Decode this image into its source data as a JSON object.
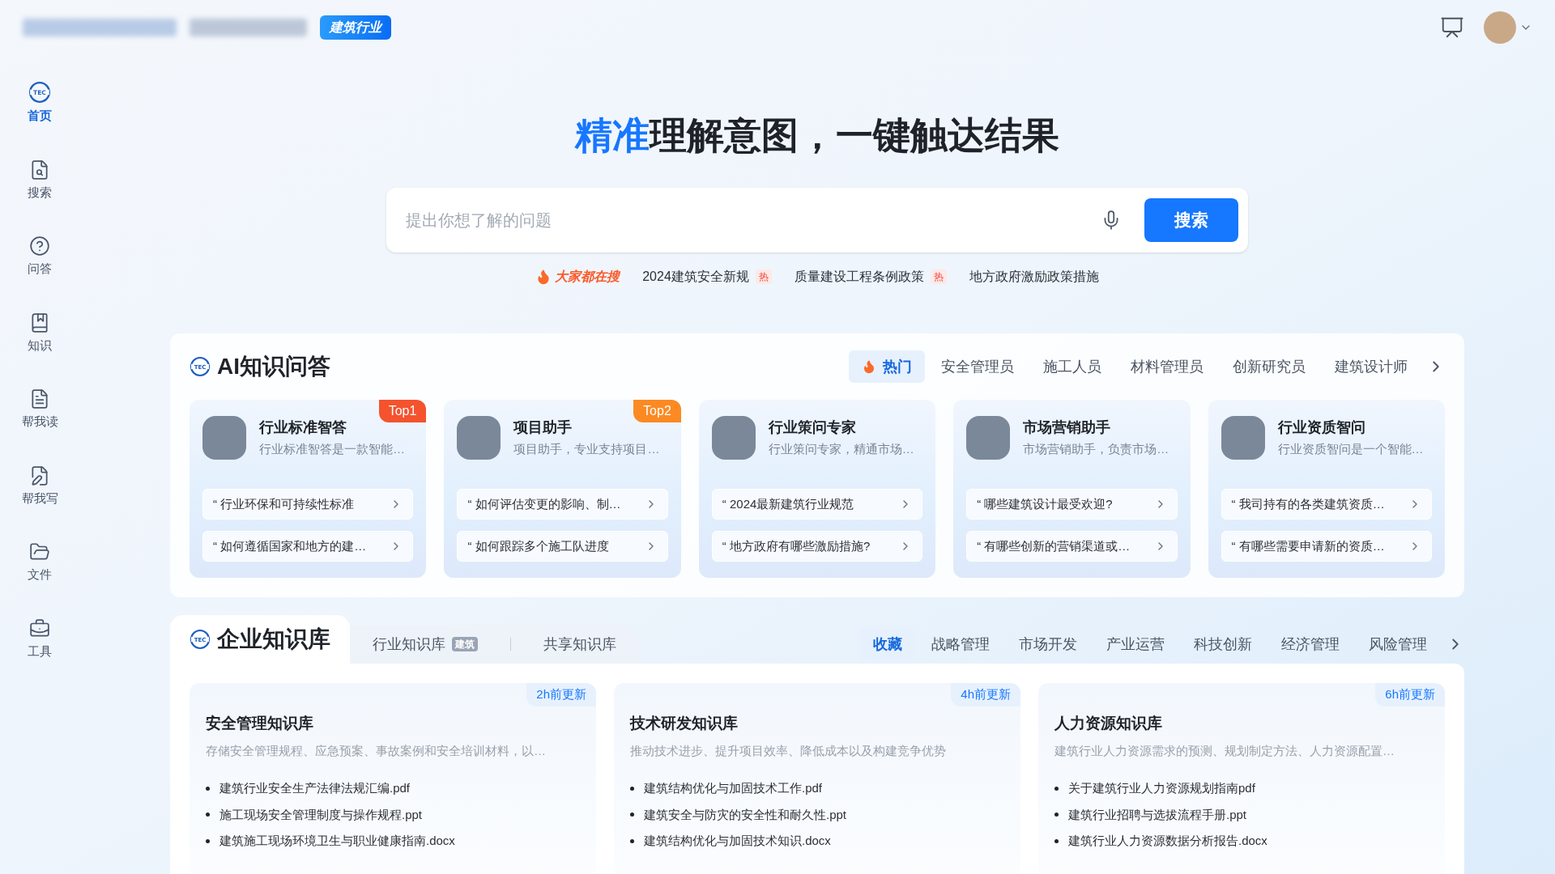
{
  "header": {
    "industry_badge": "建筑行业"
  },
  "sidebar": {
    "items": [
      {
        "label": "首页",
        "logo_text": "TEC",
        "selected": true
      },
      {
        "label": "搜索",
        "selected": false
      },
      {
        "label": "问答",
        "selected": false
      },
      {
        "label": "知识",
        "selected": false
      },
      {
        "label": "帮我读",
        "selected": false
      },
      {
        "label": "帮我写",
        "selected": false
      },
      {
        "label": "文件",
        "selected": false
      },
      {
        "label": "工具",
        "selected": false
      }
    ]
  },
  "hero": {
    "title_highlight": "精准",
    "title_rest": "理解意图，一键触达结果",
    "search": {
      "placeholder": "提出你想了解的问题",
      "button": "搜索"
    },
    "trending_label": "大家都在搜",
    "trending": [
      {
        "text": "2024建筑安全新规",
        "tag": "热"
      },
      {
        "text": "质量建设工程条例政策",
        "tag": "热"
      },
      {
        "text": "地方政府激励政策措施"
      }
    ]
  },
  "ai_qa": {
    "logo_text": "TEC",
    "title": "AI知识问答",
    "tabs": [
      {
        "label": "热门",
        "selected": true
      },
      {
        "label": "安全管理员",
        "selected": false
      },
      {
        "label": "施工人员",
        "selected": false
      },
      {
        "label": "材料管理员",
        "selected": false
      },
      {
        "label": "创新研究员",
        "selected": false
      },
      {
        "label": "建筑设计师",
        "selected": false
      }
    ],
    "cards": [
      {
        "name": "行业标准智答",
        "desc": "行业标准智答是一款智能…",
        "badge": {
          "text": "Top1",
          "color": "#f4532e"
        },
        "questions": [
          "“ 行业环保和可持续性标准",
          "“ 如何遵循国家和地方的建…"
        ]
      },
      {
        "name": "项目助手",
        "desc": "项目助手，专业支持项目…",
        "badge": {
          "text": "Top2",
          "color": "#fb8a23"
        },
        "questions": [
          "“ 如何评估变更的影响、制…",
          "“ 如何跟踪多个施工队进度"
        ]
      },
      {
        "name": "行业策问专家",
        "desc": "行业策问专家，精通市场…",
        "questions": [
          "“ 2024最新建筑行业规范",
          "“ 地方政府有哪些激励措施?"
        ]
      },
      {
        "name": "市场营销助手",
        "desc": "市场营销助手，负责市场…",
        "questions": [
          "“ 哪些建筑设计最受欢迎?",
          "“ 有哪些创新的营销渠道或…"
        ]
      },
      {
        "name": "行业资质智问",
        "desc": "行业资质智问是一个智能…",
        "questions": [
          "“ 我司持有的各类建筑资质…",
          "“ 有哪些需要申请新的资质…"
        ]
      }
    ]
  },
  "knowledge": {
    "logo_text": "TEC",
    "title": "企业知识库",
    "sources": [
      {
        "label": "行业知识库",
        "tag": "建筑"
      },
      {
        "label": "共享知识库"
      }
    ],
    "tabs": [
      {
        "label": "收藏",
        "selected": true
      },
      {
        "label": "战略管理",
        "selected": false
      },
      {
        "label": "市场开发",
        "selected": false
      },
      {
        "label": "产业运营",
        "selected": false
      },
      {
        "label": "科技创新",
        "selected": false
      },
      {
        "label": "经济管理",
        "selected": false
      },
      {
        "label": "风险管理",
        "selected": false
      }
    ],
    "cards": [
      {
        "updated": "2h前更新",
        "title": "安全管理知识库",
        "desc": "存储安全管理规程、应急预案、事故案例和安全培训材料，以…",
        "files": [
          "建筑行业安全生产法律法规汇编.pdf",
          "施工现场安全管理制度与操作规程.ppt",
          "建筑施工现场环境卫生与职业健康指南.docx"
        ]
      },
      {
        "updated": "4h前更新",
        "title": "技术研发知识库",
        "desc": "推动技术进步、提升项目效率、降低成本以及构建竞争优势",
        "files": [
          "建筑结构优化与加固技术工作.pdf",
          "建筑安全与防灾的安全性和耐久性.ppt",
          "建筑结构优化与加固技术知识.docx"
        ]
      },
      {
        "updated": "6h前更新",
        "title": "人力资源知识库",
        "desc": "建筑行业人力资源需求的预测、规划制定方法、人力资源配置…",
        "files": [
          "关于建筑行业人力资源规划指南pdf",
          "建筑行业招聘与选拔流程手册.ppt",
          "建筑行业人力资源数据分析报告.docx"
        ]
      }
    ]
  }
}
